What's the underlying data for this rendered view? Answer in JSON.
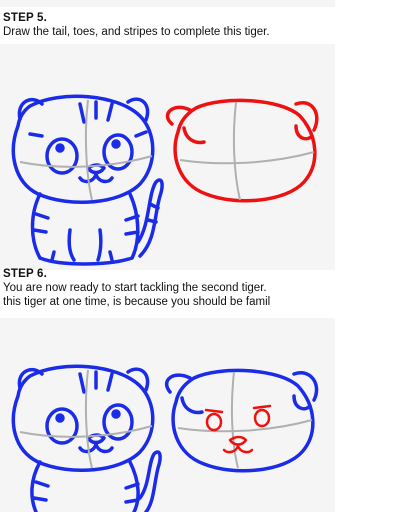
{
  "step5": {
    "title": "STEP 5.",
    "text": "Draw the tail, toes, and stripes to complete this tiger."
  },
  "step6": {
    "title": "STEP 6.",
    "text_line1": "You are now ready to start tackling the second tiger.",
    "text_line2": "this tiger at one time, is because you should be famil"
  },
  "colors": {
    "ink_blue": "#1a2ce8",
    "ink_red": "#ee1111",
    "guide_gray": "#b0b0b0",
    "panel_bg": "#f5f5f5"
  }
}
